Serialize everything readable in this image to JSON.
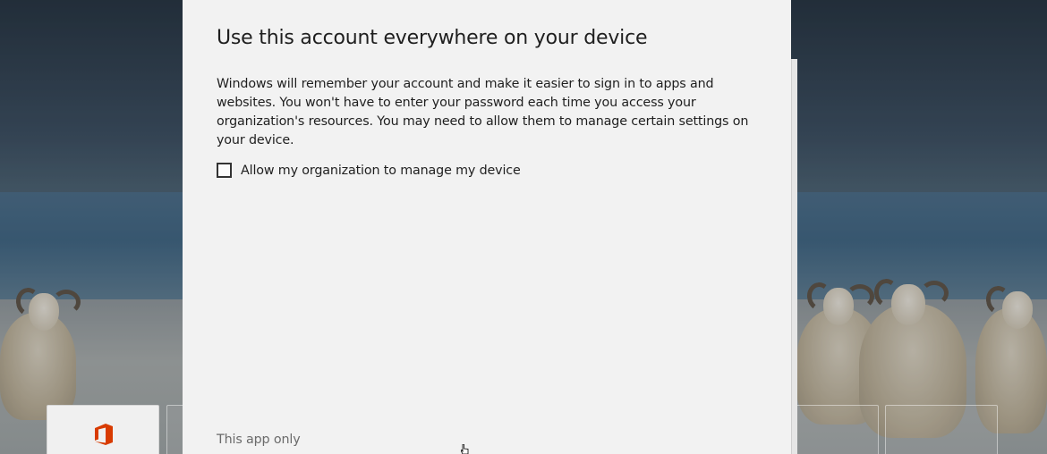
{
  "dialog": {
    "title": "Use this account everywhere on your device",
    "description": "Windows will remember your account and make it easier to sign in to apps and websites. You won't have to enter your password each time you access your organization's resources. You may need to allow them to manage certain settings on your device.",
    "manage_checkbox": {
      "label": "Allow my organization to manage my device",
      "checked": false
    },
    "this_app_only_link": "This app only"
  },
  "background_tiles": {
    "office_icon": "office-logo-icon",
    "office_color": "#d83b01"
  },
  "colors": {
    "dialog_background": "#f2f2f2",
    "text": "#1f1f1f",
    "link_text": "#6b6b6b"
  }
}
